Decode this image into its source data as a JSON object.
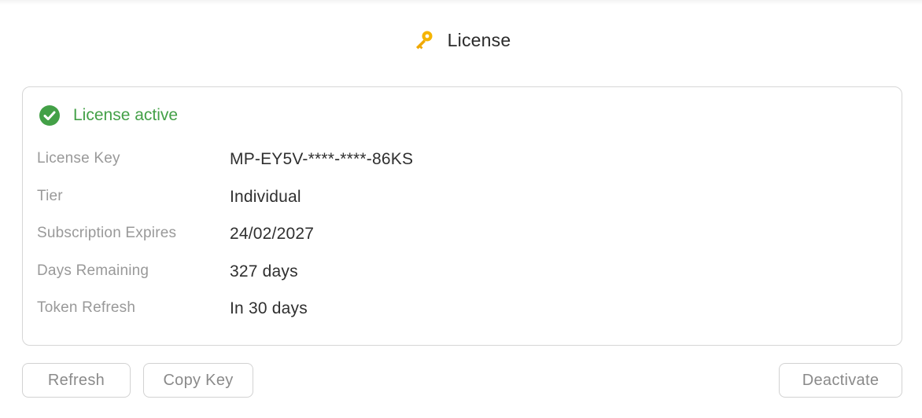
{
  "header": {
    "icon": "key-icon",
    "title": "License"
  },
  "status": {
    "icon": "check-circle-icon",
    "text": "License active",
    "color": "#43a047"
  },
  "details": [
    {
      "label": "License Key",
      "value": "MP-EY5V-****-****-86KS"
    },
    {
      "label": "Tier",
      "value": "Individual"
    },
    {
      "label": "Subscription Expires",
      "value": "24/02/2027"
    },
    {
      "label": "Days Remaining",
      "value": "327 days"
    },
    {
      "label": "Token Refresh",
      "value": "In 30 days"
    }
  ],
  "actions": {
    "refresh_label": "Refresh",
    "copy_label": "Copy Key",
    "deactivate_label": "Deactivate"
  },
  "colors": {
    "accent_key": "#f5b400",
    "success": "#43a047",
    "label": "#999999",
    "border": "#d6d6d6"
  }
}
